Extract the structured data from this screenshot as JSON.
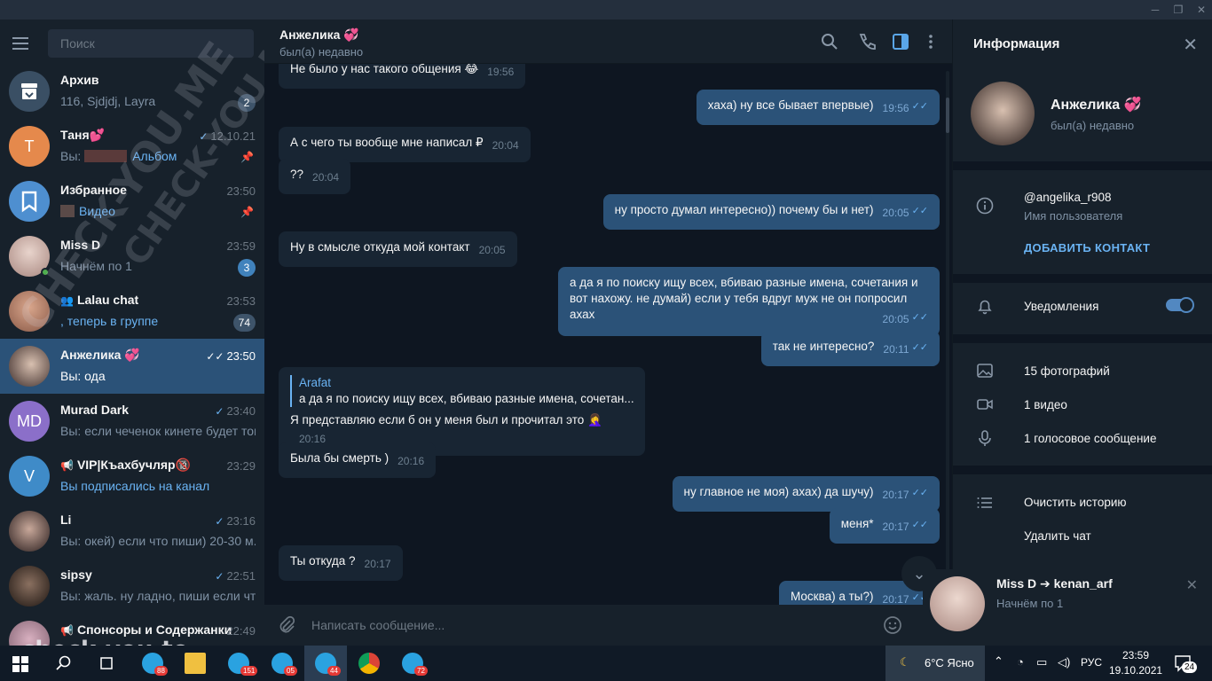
{
  "window": {
    "minimize_glyph": "─",
    "maximize_glyph": "❐",
    "close_glyph": "✕"
  },
  "sidebar": {
    "search_placeholder": "Поиск",
    "chats": [
      {
        "name": "Архив",
        "time": "",
        "preview": "116, Sjdjdj, Layra",
        "badge": "2",
        "avatar_color": "#3a4f64",
        "avatar_icon": "archive-icon"
      },
      {
        "name": "Таня💕",
        "time": "12.10.21",
        "preview_prefix": "Вы: ",
        "preview": "Альбом",
        "avatar_letter": "Т",
        "avatar_color": "#e5894c",
        "check": "✓",
        "pinned": true
      },
      {
        "name": "Избранное",
        "time": "23:50",
        "preview": "Видео",
        "avatar_color": "#4e8fd0",
        "avatar_icon": "bookmark-icon",
        "pinned": true
      },
      {
        "name": "Miss D",
        "time": "23:59",
        "preview": "Начнём по 1",
        "badge": "3",
        "avatar_color": "#c9a7a0",
        "online": true
      },
      {
        "name": "Lalau chat",
        "time": "23:53",
        "preview": ", теперь в группе",
        "badge": "74",
        "avatar_color": "#b4836c",
        "group": true
      },
      {
        "name": "Анжелика 💞",
        "time": "23:50",
        "preview": "Вы: ода",
        "avatar_color": "#5a4a48",
        "check": "✓✓",
        "active": true
      },
      {
        "name": "Murad Dark",
        "time": "23:40",
        "preview_prefix": "Вы: ",
        "preview": "если чеченок кинете будет топ",
        "avatar_letter": "MD",
        "avatar_color": "#8b6fc9",
        "check": "✓"
      },
      {
        "name": "VIP|Къахбучляр🔞",
        "time": "23:29",
        "preview": "Вы подписались на канал",
        "avatar_letter": "V",
        "avatar_color": "#3f8bc8",
        "channel": true
      },
      {
        "name": "Li",
        "time": "23:16",
        "preview_prefix": "Вы: ",
        "preview": "окей) если что пиши) 20-30 м...",
        "avatar_color": "#6a5050",
        "check": "✓"
      },
      {
        "name": "sipsy",
        "time": "22:51",
        "preview_prefix": "Вы: ",
        "preview": "жаль. ну ладно, пиши если что)",
        "avatar_color": "#4a3a30",
        "check": "✓"
      },
      {
        "name": "Спонсоры и Содержанки",
        "time": "22:49",
        "preview": "",
        "avatar_color": "#a08090",
        "channel": true
      }
    ]
  },
  "header": {
    "name": "Анжелика 💞",
    "status": "был(а) недавно"
  },
  "messages": [
    {
      "dir": "in",
      "text": "Не было у нас такого общения 😂",
      "time": "19:56"
    },
    {
      "dir": "out",
      "text": "хаха) ну все бывает впервые)",
      "time": "19:56"
    },
    {
      "dir": "in",
      "text": "А с чего ты вообще мне написал ₽",
      "time": "20:04"
    },
    {
      "dir": "in",
      "text": "??",
      "time": "20:04"
    },
    {
      "dir": "out",
      "text": "ну просто думал интересно)) почему бы и нет)",
      "time": "20:05"
    },
    {
      "dir": "in",
      "text": "Ну в смысле откуда мой контакт",
      "time": "20:05"
    },
    {
      "dir": "out",
      "text": "а да я по поиску ищу всех, вбиваю разные имена, сочетания и\nвот нахожу. не думай) если у тебя вдруг муж не он попросил\naхах",
      "time": "20:05"
    },
    {
      "dir": "out",
      "text": "так не интересно?",
      "time": "20:11"
    },
    {
      "dir": "in",
      "reply_name": "Arafat",
      "reply_text": "а да я по поиску ищу всех, вбиваю разные имена, сочетан...",
      "text": "Я представляю если б он у меня был и прочитал это 🤦‍♀️",
      "time": "20:16"
    },
    {
      "dir": "in",
      "text": "Была бы смерть )",
      "time": "20:16"
    },
    {
      "dir": "out",
      "text": "ну главное не моя) ахах) да шучу)",
      "time": "20:17"
    },
    {
      "dir": "out",
      "text": "меня*",
      "time": "20:17"
    },
    {
      "dir": "in",
      "text": "Ты откуда ?",
      "time": "20:17"
    },
    {
      "dir": "out",
      "text": "Москва) а ты?)",
      "time": "20:17"
    }
  ],
  "composer": {
    "placeholder": "Написать сообщение..."
  },
  "info": {
    "title": "Информация",
    "name": "Анжелика 💞",
    "status": "был(а) недавно",
    "username": "@angelika_r908",
    "username_label": "Имя пользователя",
    "add_contact": "ДОБАВИТЬ КОНТАКТ",
    "notifications": "Уведомления",
    "notifications_on": true,
    "photos": "15 фотографий",
    "videos": "1 видео",
    "voice": "1 голосовое сообщение",
    "clear_history": "Очистить историю",
    "delete_chat": "Удалить чат"
  },
  "notification": {
    "title": "Miss D ➔ kenan_arf",
    "text": "Начнём по 1"
  },
  "watermark": {
    "diagonal": "CHECK-YOU.ME",
    "bottom": "check-you.to"
  },
  "taskbar": {
    "apps": [
      {
        "icon": "telegram-icon",
        "count": "88"
      },
      {
        "icon": "folder-icon",
        "count": ""
      },
      {
        "icon": "telegram-icon",
        "count": "151"
      },
      {
        "icon": "telegram-icon",
        "count": "05"
      },
      {
        "icon": "telegram-icon",
        "count": "44",
        "active": true
      },
      {
        "icon": "chrome-icon",
        "count": ""
      },
      {
        "icon": "telegram-icon",
        "count": "72"
      }
    ],
    "weather": "6°C  Ясно",
    "lang": "РУС",
    "time": "23:59",
    "date": "19.10.2021",
    "notif_count": "24"
  },
  "colors": {
    "sidebar_bg": "#17212b",
    "chat_bg": "#0e1621",
    "outgoing": "#2b5278",
    "incoming": "#182533",
    "accent": "#6ab3f3"
  }
}
